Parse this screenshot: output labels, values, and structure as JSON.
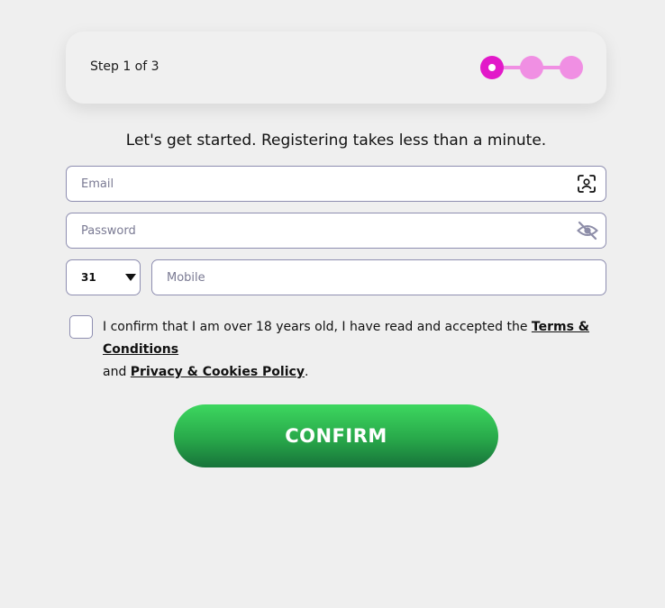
{
  "stepper": {
    "label": "Step 1 of 3",
    "current_step": 1,
    "total_steps": 3,
    "colors": {
      "active": "#e219c9",
      "inactive": "#f08fe3"
    }
  },
  "intro": "Let's get started. Registering takes less than a minute.",
  "email": {
    "placeholder": "Email",
    "icon": "face-scan-icon"
  },
  "password": {
    "placeholder": "Password",
    "icon": "eye-off-icon"
  },
  "phone": {
    "country_code": "31",
    "placeholder": "Mobile"
  },
  "consent": {
    "text_before": "I confirm that I am over 18 years old, I have read and accepted the ",
    "terms_link": "Terms & Conditions",
    "text_middle": "and ",
    "privacy_link": "Privacy & Cookies Policy",
    "text_after": "."
  },
  "confirm_button": {
    "label": "CONFIRM",
    "color": "#28a84a"
  }
}
